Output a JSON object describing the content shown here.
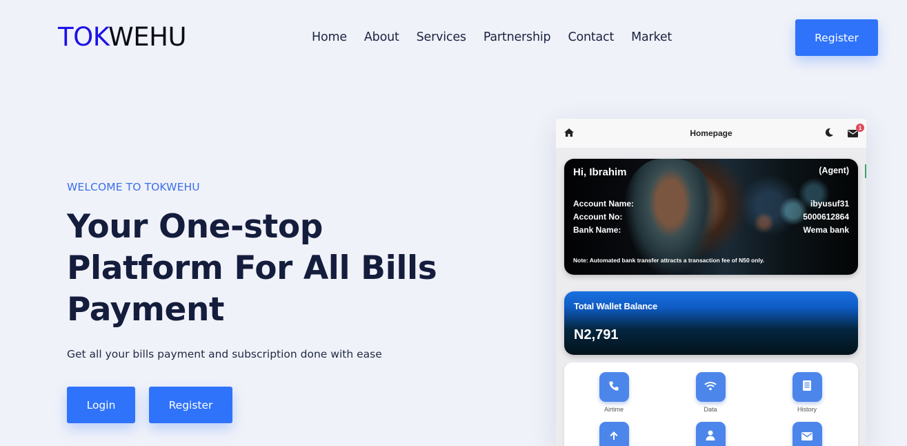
{
  "brand": {
    "logo_part1": "TOK",
    "logo_part2": "WEHU",
    "accent": "#1d12e6"
  },
  "nav": {
    "items": [
      {
        "label": "Home"
      },
      {
        "label": "About"
      },
      {
        "label": "Services"
      },
      {
        "label": "Partnership"
      },
      {
        "label": "Contact"
      },
      {
        "label": "Market"
      }
    ],
    "register_label": "Register"
  },
  "hero": {
    "eyebrow": "WELCOME TO TOKWEHU",
    "headline": "Your One-stop Platform For All Bills Payment",
    "subtitle": "Get all your bills payment and subscription done with ease",
    "login_label": "Login",
    "register_label": "Register",
    "button_color": "#2f73fb"
  },
  "phone": {
    "title": "Homepage",
    "notification_count": "1",
    "account_card": {
      "greeting": "Hi, Ibrahim",
      "role": "(Agent)",
      "account_name_label": "Account Name:",
      "account_name": "ibyusuf31",
      "account_no_label": "Account No:",
      "account_no": "5000612864",
      "bank_name_label": "Bank Name:",
      "bank_name": "Wema bank",
      "note": "Note: Automated bank transfer attracts a transaction fee of N50 only."
    },
    "wallet": {
      "label": "Total Wallet Balance",
      "balance": "N2,791"
    },
    "services": [
      {
        "label": "Airtime",
        "icon": "phone-icon"
      },
      {
        "label": "Data",
        "icon": "wifi-icon"
      },
      {
        "label": "History",
        "icon": "document-icon"
      },
      {
        "label": "",
        "icon": "upload-icon"
      },
      {
        "label": "",
        "icon": "user-icon"
      },
      {
        "label": "",
        "icon": "envelope-icon"
      }
    ]
  }
}
